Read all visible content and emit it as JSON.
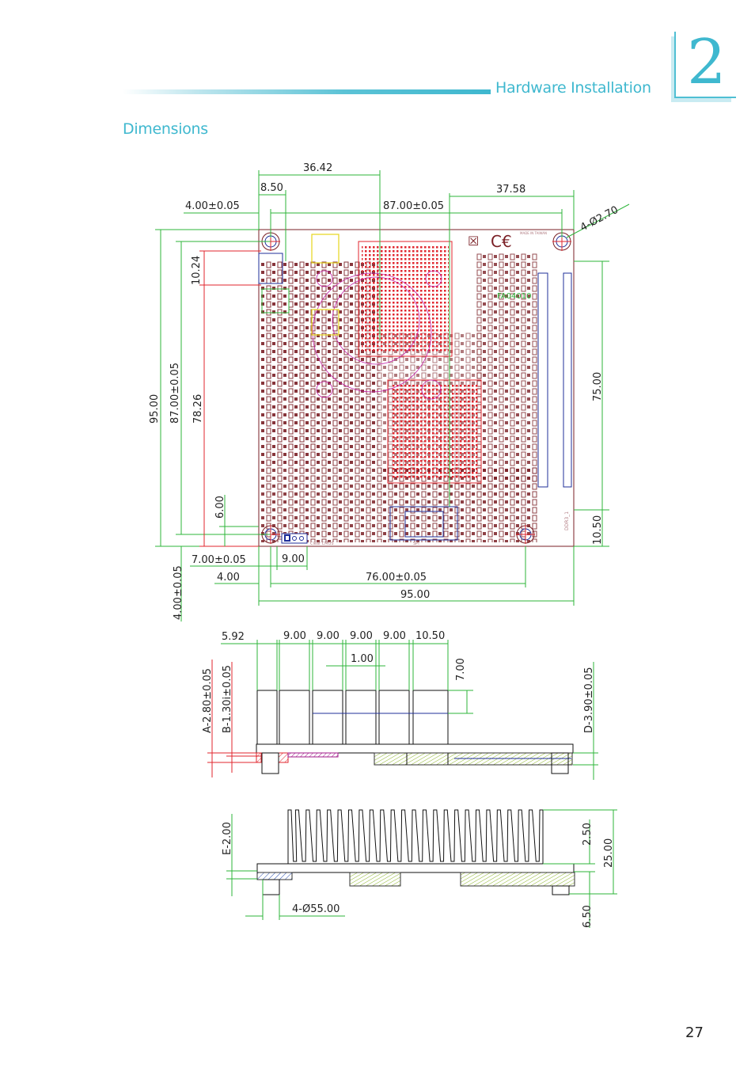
{
  "header": {
    "section_title": "Hardware Installation",
    "chapter_number": "2",
    "accent_color": "#3fb8cf"
  },
  "page": {
    "heading": "Dimensions",
    "page_number": "27"
  },
  "top_view": {
    "labels": {
      "top_36_42": "36.42",
      "top_8_50": "8.50",
      "top_4_00": "4.00±0.05",
      "top_87_00": "87.00±0.05",
      "top_37_58": "37.58",
      "hole_callout": "4-Ø2.70",
      "left_95_00": "95.00",
      "left_87_00": "87.00±0.05",
      "left_78_26": "78.26",
      "left_10_24": "10.24",
      "left_6_00": "6.00",
      "left_4_00": "4.00±0.05",
      "right_75_00": "75.00",
      "right_10_50": "10.50",
      "bottom_7_00": "7.00±0.05",
      "bottom_9_00": "9.00",
      "bottom_4_00": "4.00",
      "bottom_76_00": "76.00±0.05",
      "bottom_95_00": "95.00"
    },
    "board_markings": {
      "clear_cmos": "Clear CMOS",
      "spi": "SPI",
      "ddr3": "DDR3_1",
      "made_in": "MADE IN TAIWAN",
      "chip_label": "FA04010"
    }
  },
  "side_view": {
    "labels": {
      "w_5_92": "5.92",
      "w_9_00_a": "9.00",
      "w_9_00_b": "9.00",
      "w_9_00_c": "9.00",
      "w_9_00_d": "9.00",
      "w_10_50": "10.50",
      "gap_1_00": "1.00",
      "h_7_00": "7.00",
      "a_2_80": "A-2.80±0.05",
      "b_1_30": "B-1.30i±0.05",
      "d_3_90": "D-3.90±0.05"
    }
  },
  "heatsink_view": {
    "labels": {
      "e_2_00": "E-2.00",
      "fin_2_50": "2.50",
      "total_25_00": "25.00",
      "standoff_6_50": "6.50",
      "standoff_dia": "4-Ø55.00"
    }
  }
}
